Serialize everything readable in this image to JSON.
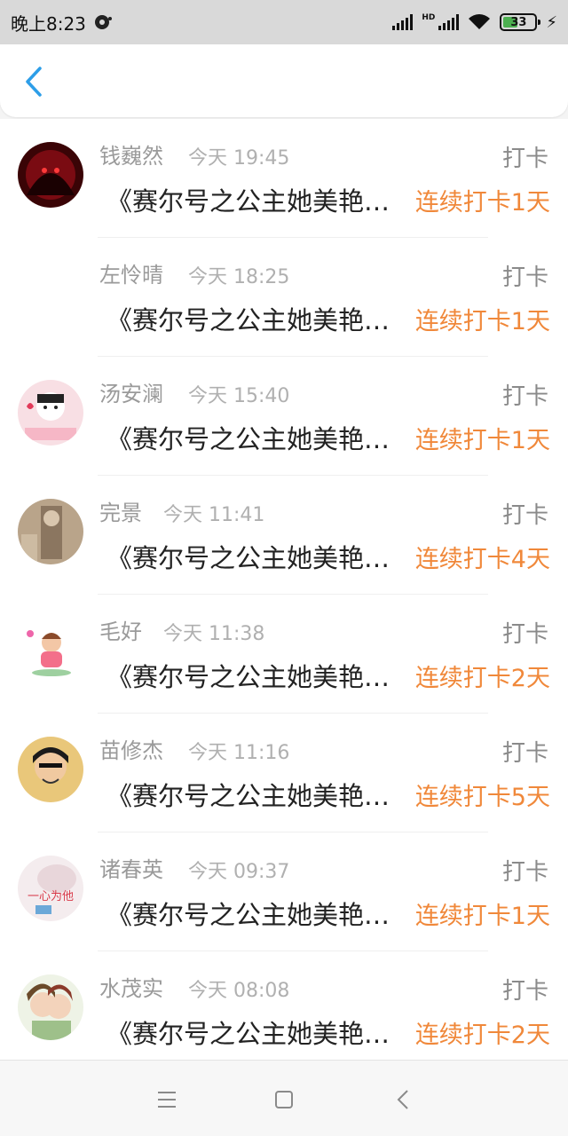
{
  "status_bar": {
    "time": "晚上8:23",
    "battery": "33",
    "hd_label": "HD"
  },
  "header": {
    "back_icon": "chevron-left-icon",
    "accent": "#2d9ee8"
  },
  "colors": {
    "streak": "#f0883a",
    "name": "#9a9a9a"
  },
  "list": {
    "items": [
      {
        "name": "钱巍然",
        "time": "今天 19:45",
        "tag": "打卡",
        "title": "《赛尔号之公主她美艳动人》",
        "streak": "连续打卡1天"
      },
      {
        "name": "左怜晴",
        "time": "今天 18:25",
        "tag": "打卡",
        "title": "《赛尔号之公主她美艳动人》",
        "streak": "连续打卡1天"
      },
      {
        "name": "汤安澜",
        "time": "今天 15:40",
        "tag": "打卡",
        "title": "《赛尔号之公主她美艳动人》",
        "streak": "连续打卡1天"
      },
      {
        "name": "完景",
        "time": "今天 11:41",
        "tag": "打卡",
        "title": "《赛尔号之公主她美艳动人》",
        "streak": "连续打卡4天"
      },
      {
        "name": "毛好",
        "time": "今天 11:38",
        "tag": "打卡",
        "title": "《赛尔号之公主她美艳动人》",
        "streak": "连续打卡2天"
      },
      {
        "name": "苗修杰",
        "time": "今天 11:16",
        "tag": "打卡",
        "title": "《赛尔号之公主她美艳动人》",
        "streak": "连续打卡5天"
      },
      {
        "name": "诸春英",
        "time": "今天 09:37",
        "tag": "打卡",
        "title": "《赛尔号之公主她美艳动人》",
        "streak": "连续打卡1天"
      },
      {
        "name": "水茂实",
        "time": "今天 08:08",
        "tag": "打卡",
        "title": "《赛尔号之公主她美艳动人》",
        "streak": "连续打卡2天"
      }
    ],
    "avatar_text_7": "一心为他"
  },
  "nav": {
    "menu_icon": "menu-icon",
    "home_icon": "home-square-icon",
    "back_icon": "back-triangle-icon"
  }
}
